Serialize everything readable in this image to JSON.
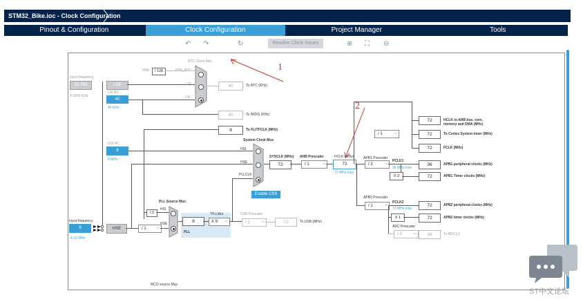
{
  "app": {
    "title": "STM32_Bike.ioc - Clock Configuration"
  },
  "tabs": [
    {
      "label": "Pinout & Configuration"
    },
    {
      "label": "Clock Configuration"
    },
    {
      "label": "Project Manager"
    },
    {
      "label": "Tools"
    }
  ],
  "toolbar": {
    "reset_label": "Resolve Clock Issues"
  },
  "annotations": {
    "a1": "1",
    "a2": "2"
  },
  "clock": {
    "input_freq_label": "Input frequency",
    "lse_value": "32.768",
    "lse_range": "0-1000 KHz",
    "lse_label": "LSE",
    "lsi_rc_label": "LSI RC",
    "lsi_value": "40",
    "lsi_freq": "40 KHz",
    "rtc_mux_label": "RTC Clock Mux",
    "hse_label_small": "HSE",
    "rtc_div": "/ 128",
    "hse_rtc": "HSE_RTC",
    "lse_small": "LSE",
    "lsi_small": "LSI",
    "rtc_value": "40",
    "rtc_out": "To RTC (KHz)",
    "iwdg_value": "40",
    "iwdg_out": "To IWDG (KHz)",
    "flit_value": "8",
    "flit_out": "To FLITFCLK (MHz)",
    "hsi_rc_label": "HSI RC",
    "hsi_value": "8",
    "hsi_freq": "8 MHz",
    "sys_mux_label": "System Clock Mux",
    "hsi_small": "HSI",
    "hse_small2": "HSE",
    "pllclk_label": "PLLCLK",
    "sysclk_label": "SYSCLK (MHz)",
    "sysclk_value": "72",
    "ahb_label": "AHB Prescaler",
    "ahb_value": "/ 1",
    "hclk_label": "HCLK (MHz)",
    "hclk_value": "72",
    "hclk_max": "72 MHz max",
    "enable_css": "Enable CSS",
    "hclk_ahb_value": "72",
    "hclk_ahb_label": "HCLK to AHB bus, core, memory and DMA (MHz)",
    "cortex_div": "/ 1",
    "cortex_value": "72",
    "cortex_label": "To Cortex System timer (MHz)",
    "fclk_value": "72",
    "fclk_label": "FCLK (MHz)",
    "apb1_label": "APB1 Prescaler",
    "apb1_value": "/ 2",
    "pclk1_label": "PCLK1",
    "pclk1_max": "36 MHz max",
    "apb1_periph_value": "36",
    "apb1_periph_label": "APB1 peripheral clocks (MHz)",
    "x2": "X 2",
    "apb1_timer_value": "72",
    "apb1_timer_label": "APB1 Timer clocks (MHz)",
    "apb2_label": "APB2 Prescaler",
    "apb2_value": "/ 1",
    "pclk2_label": "PCLK2",
    "pclk2_max": "72 MHz max",
    "apb2_periph_value": "72",
    "apb2_periph_label": "APB2 peripheral clocks (MHz)",
    "x1": "X 1",
    "apb2_timer_value": "72",
    "apb2_timer_label": "APB2 timer clocks (MHz)",
    "adc_label": "ADC Prescaler",
    "adc_value": "/ 2",
    "adc_out_value": "36",
    "adc_out_label": "To ADC1,2",
    "hse_input_value": "8",
    "hse_input_range": "4-16 MHz",
    "hse_label": "HSE",
    "hse_div": "/ 1",
    "pll_mux_label": "PLL Source Mux",
    "pll_div2": "/ 2",
    "hsi_pll": "HSI",
    "hse_pll": "HSE",
    "pll_label": "PLL",
    "pll_in_value": "8",
    "pllmul_label": "*PLLMul",
    "pllmul_value": "X 9",
    "usb_label": "USB Prescaler",
    "usb_div": "/ 1",
    "usb_value": "72",
    "usb_out": "To USB (MHz)",
    "mco_label": "MCO source Mux"
  },
  "watermark": {
    "text": "ST中文论坛"
  }
}
